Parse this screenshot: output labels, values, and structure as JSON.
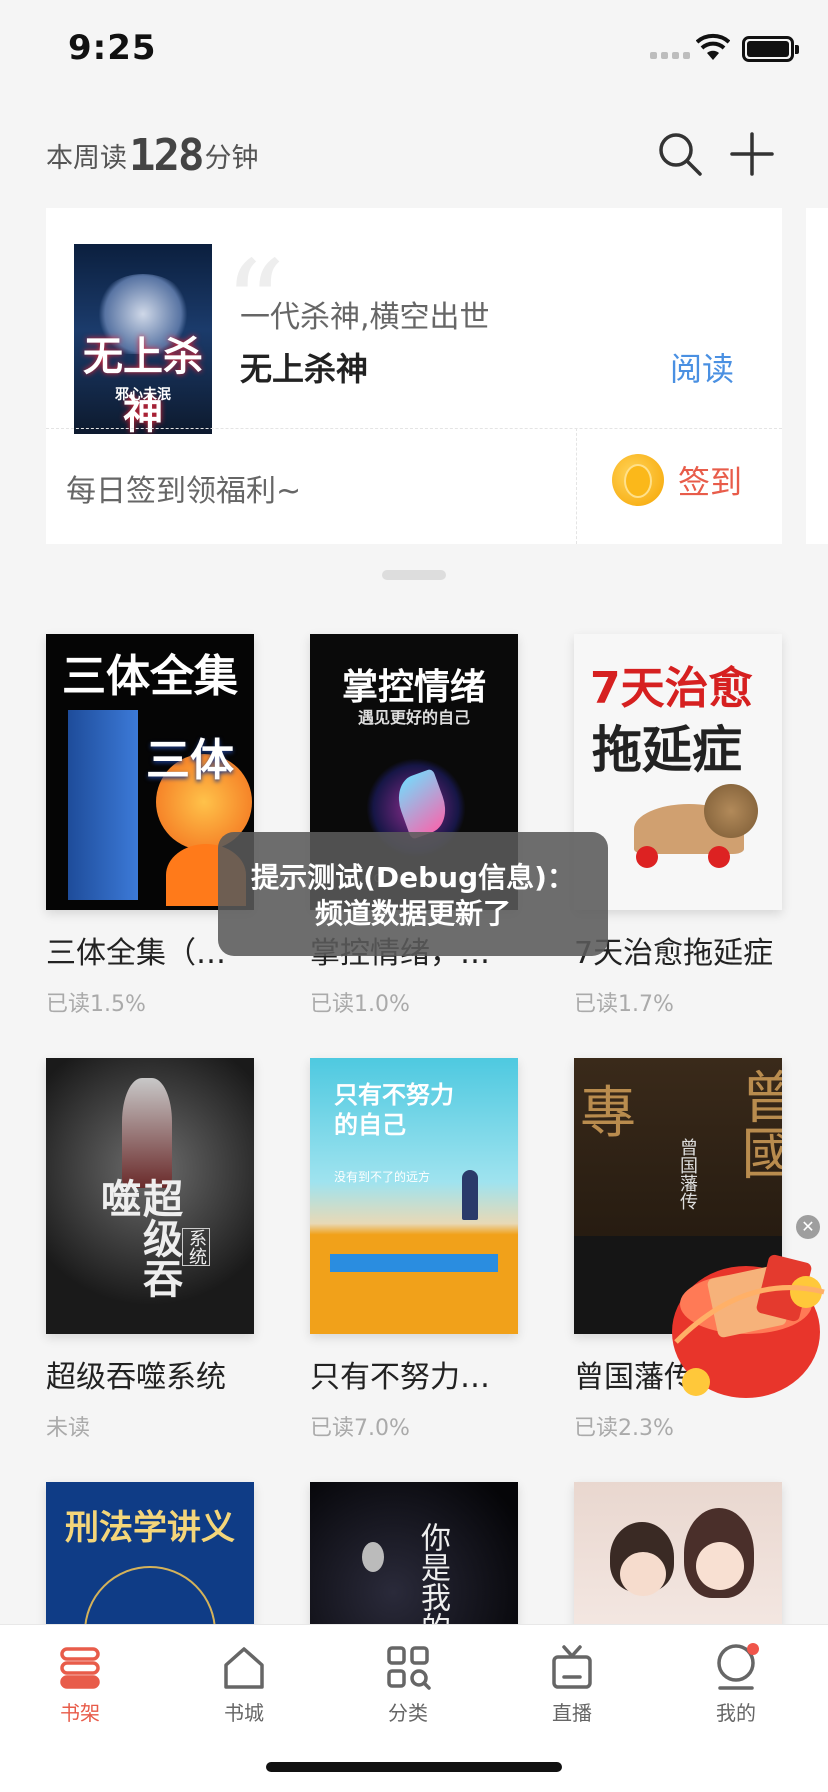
{
  "status_bar": {
    "time": "9:25"
  },
  "header": {
    "reading_prefix": "本周读",
    "reading_minutes": "128",
    "reading_suffix": "分钟",
    "search_icon": "search-icon",
    "add_icon": "plus-icon"
  },
  "recommend_card": {
    "slogan": "一代杀神,横空出世",
    "title": "无上杀神",
    "read_label": "阅读",
    "cover_title": "无上杀神",
    "cover_author": "邪心未泯",
    "welfare_text": "每日签到领福利~",
    "sign_label": "签到"
  },
  "toast": {
    "line1": "提示测试(Debug信息)：",
    "line2": "频道数据更新了"
  },
  "books": [
    {
      "title": "三体全集（…",
      "progress": "已读1.5%",
      "cover_text": "三体全集",
      "cover_sub": "三体"
    },
    {
      "title": "掌控情绪，…",
      "progress": "已读1.0%",
      "cover_text": "掌控情绪",
      "cover_sub": "遇见更好的自己"
    },
    {
      "title": "7天治愈拖延症",
      "progress": "已读1.7%",
      "cover_text": "7天治愈",
      "cover_sub": "拖延症"
    },
    {
      "title": "超级吞噬系统",
      "progress": "未读",
      "cover_text": "超级吞噬",
      "cover_sub": "系统"
    },
    {
      "title": "只有不努力…",
      "progress": "已读7.0%",
      "cover_text": "只有不努力的自己",
      "cover_sub": "没有到不了的远方"
    },
    {
      "title": "曾国藩传",
      "progress": "已读2.3%",
      "cover_text": "曾国藩传",
      "cover_sub": "曾國"
    },
    {
      "title": "",
      "progress": "",
      "cover_text": "刑法学讲义",
      "cover_sub": ""
    },
    {
      "title": "",
      "progress": "",
      "cover_text": "你是我的",
      "cover_sub": ""
    },
    {
      "title": "",
      "progress": "",
      "cover_text": "",
      "cover_sub": ""
    }
  ],
  "tabs": [
    {
      "label": "书架",
      "icon": "bookshelf-icon",
      "active": true
    },
    {
      "label": "书城",
      "icon": "home-icon",
      "active": false
    },
    {
      "label": "分类",
      "icon": "category-icon",
      "active": false
    },
    {
      "label": "直播",
      "icon": "tv-icon",
      "active": false
    },
    {
      "label": "我的",
      "icon": "profile-icon",
      "active": false
    }
  ],
  "colors": {
    "accent": "#e85c4a",
    "link": "#4a90e2",
    "background": "#f5f5f5"
  }
}
